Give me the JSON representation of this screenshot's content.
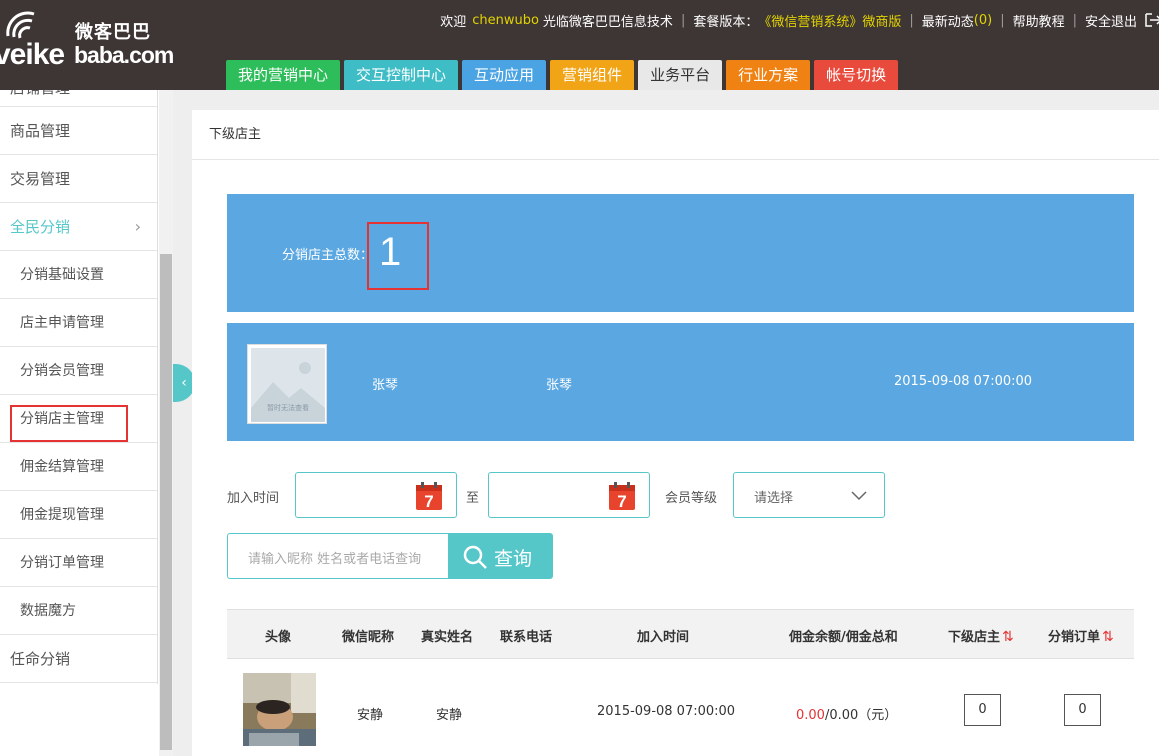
{
  "header": {
    "logo_cn": "微客巴巴",
    "logo_main": "veike",
    "logo_sub": "baba.com",
    "welcome": "欢迎",
    "username": "chenwubo",
    "welcome_suffix": "光临微客巴巴信息技术",
    "package_label": "套餐版本：",
    "package_value": "《微信营销系统》微商版",
    "news_label": "最新动态",
    "news_count": "(0)",
    "help": "帮助教程",
    "logout": "安全退出"
  },
  "mainnav": [
    {
      "label": "我的营销中心",
      "color": "#2dbd5a"
    },
    {
      "label": "交互控制中心",
      "color": "#3ebdc6"
    },
    {
      "label": "互动应用",
      "color": "#4aa3e3"
    },
    {
      "label": "营销组件",
      "color": "#f2a417"
    },
    {
      "label": "业务平台",
      "color": "#e8e8e8"
    },
    {
      "label": "行业方案",
      "color": "#ef8213"
    },
    {
      "label": "帐号切换",
      "color": "#e84a3c"
    }
  ],
  "sidebar": {
    "cut_item": "店铺管理",
    "items": [
      {
        "label": "商品管理"
      },
      {
        "label": "交易管理"
      },
      {
        "label": "全民分销",
        "chevron": "›"
      }
    ],
    "subitems": [
      {
        "label": "分销基础设置"
      },
      {
        "label": "店主申请管理"
      },
      {
        "label": "分销会员管理"
      },
      {
        "label": "分销店主管理"
      },
      {
        "label": "佣金结算管理"
      },
      {
        "label": "佣金提现管理"
      },
      {
        "label": "分销订单管理"
      },
      {
        "label": "数据魔方"
      }
    ],
    "last_item": "任命分销",
    "toggle": "‹"
  },
  "page": {
    "breadcrumb": "下级店主",
    "total_label": "分销店主总数：",
    "total_value": "1",
    "owner": {
      "avatar_text": "暂时无法查看",
      "nickname": "张琴",
      "realname": "张琴",
      "time": "2015-09-08 07:00:00"
    }
  },
  "filter": {
    "join_time_label": "加入时间",
    "to_label": "至",
    "calendar_day": "7",
    "level_label": "会员等级",
    "level_value": "请选择",
    "search_placeholder": "请输入昵称 姓名或者电话查询",
    "search_button": "查询"
  },
  "table": {
    "headers": [
      "头像",
      "微信昵称",
      "真实姓名",
      "联系电话",
      "加入时间",
      "佣金余额/佣金总和",
      "下级店主",
      "分销订单"
    ],
    "sort_icon": "⇅",
    "rows": [
      {
        "nickname": "安静",
        "realname": "安静",
        "phone": "",
        "time": "2015-09-08 07:00:00",
        "balance": "0.00",
        "total": "/0.00（元）",
        "sub_owners": "0",
        "orders": "0"
      }
    ]
  }
}
